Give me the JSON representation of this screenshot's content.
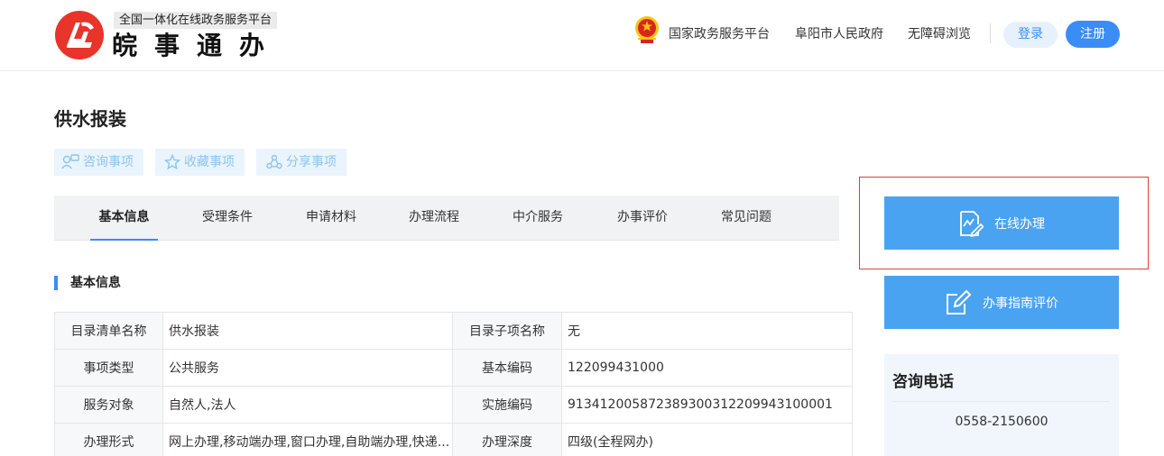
{
  "header": {
    "tagline": "全国一体化在线政务服务平台",
    "app_name": "皖事通办",
    "links": {
      "national_platform": "国家政务服务平台",
      "city_gov": "阜阳市人民政府",
      "accessibility": "无障碍浏览"
    },
    "login_label": "登录",
    "register_label": "注册",
    "icons": [
      "logo-mark",
      "national-emblem-icon"
    ]
  },
  "page": {
    "title": "供水报装",
    "actions": {
      "consult": "咨询事项",
      "favorite": "收藏事项",
      "share": "分享事项"
    }
  },
  "tabs": {
    "basic": "基本信息",
    "conditions": "受理条件",
    "materials": "申请材料",
    "process": "办理流程",
    "intermediary": "中介服务",
    "evaluation": "办事评价",
    "faq": "常见问题"
  },
  "basic_info": {
    "section_title": "基本信息",
    "rows": [
      {
        "l1": "目录清单名称",
        "v1": "供水报装",
        "l2": "目录子项名称",
        "v2": "无"
      },
      {
        "l1": "事项类型",
        "v1": "公共服务",
        "l2": "基本编码",
        "v2": "122099431000"
      },
      {
        "l1": "服务对象",
        "v1": "自然人,法人",
        "l2": "实施编码",
        "v2": "913412005872389300312209943100001"
      },
      {
        "l1": "办理形式",
        "v1": "网上办理,移动端办理,窗口办理,自助端办理,快递...",
        "l2": "办理深度",
        "v2": "四级(全程网办)"
      }
    ]
  },
  "sidebar": {
    "online_apply": "在线办理",
    "guide_evaluation": "办事指南评价",
    "consult_title": "咨询电话",
    "consult_phone": "0558-2150600"
  },
  "colors": {
    "primary": "#3a8cf7",
    "sidebar_button": "#4aa3f0",
    "highlight_border": "#e23b3b",
    "action_bg": "#eaf4fc",
    "action_text": "#8ec3ef"
  }
}
